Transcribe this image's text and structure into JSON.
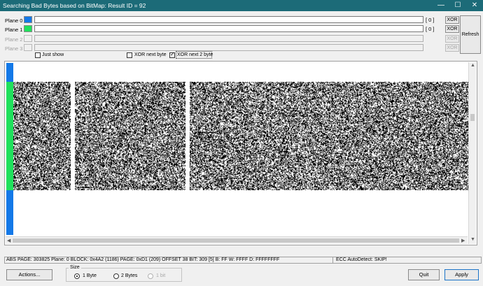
{
  "window": {
    "title": "Searching Bad Bytes based on BitMap: Result ID = 92",
    "minimize_glyph": "—",
    "maximize_glyph": "☐",
    "close_glyph": "✕"
  },
  "planes": [
    {
      "label": "Plane 0",
      "color": "#1479e8",
      "count": "[ 0 ]",
      "xor": "XOR",
      "enabled": true
    },
    {
      "label": "Plane 1",
      "color": "#1fe15c",
      "count": "[ 0 ]",
      "xor": "XOR",
      "enabled": true
    },
    {
      "label": "Plane 2",
      "color": "",
      "count": "",
      "xor": "XOR",
      "enabled": false
    },
    {
      "label": "Plane 3",
      "color": "",
      "count": "",
      "xor": "XOR",
      "enabled": false
    }
  ],
  "refresh_label": "Refresh",
  "options": {
    "just_show": {
      "label": "Just show",
      "checked": false
    },
    "xor_next_byte": {
      "label": "XOR next byte",
      "checked": false
    },
    "xor_next_2_byte": {
      "label": "XOR next 2 byte",
      "checked": true,
      "mark": "✓"
    }
  },
  "viewer": {
    "plane0_color": "#1479e8",
    "plane1_color": "#1fe15c",
    "arrows": {
      "left": "◀",
      "right": "▶",
      "up": "▲",
      "down": "▼"
    }
  },
  "status": {
    "main": "ABS PAGE: 303825   Plane: 0   BLOCK: 0x4A2 (1186)  PAGE: 0xD1 (209)  OFFSET 38   BIT: 309 [5]   B: FF  W: FFFF  D: FFFFFFFF",
    "ecc": "ECC AutoDetect: SKIP!"
  },
  "buttons": {
    "actions": "Actions...",
    "quit": "Quit",
    "apply": "Apply"
  },
  "size_group": {
    "title": "Size",
    "options": [
      {
        "label": "1 Byte",
        "selected": true,
        "enabled": true
      },
      {
        "label": "2 Bytes",
        "selected": false,
        "enabled": true
      },
      {
        "label": "1 bit",
        "selected": false,
        "enabled": false
      }
    ]
  }
}
